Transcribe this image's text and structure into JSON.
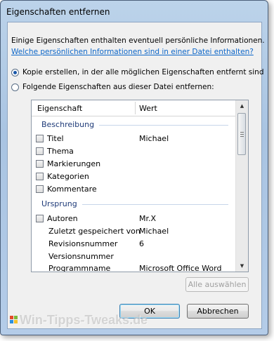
{
  "window": {
    "title": "Eigenschaften entfernen"
  },
  "info_text": "Einige Eigenschaften enthalten eventuell persönliche Informationen.",
  "info_link": "Welche persönlichen Informationen sind in einer Datei enthalten?",
  "options": [
    {
      "label": "Kopie erstellen, in der alle möglichen Eigenschaften entfernt sind",
      "selected": true
    },
    {
      "label": "Folgende Eigenschaften aus dieser Datei entfernen:",
      "selected": false
    }
  ],
  "list": {
    "columns": [
      "Eigenschaft",
      "Wert"
    ],
    "groups": [
      {
        "name": "Beschreibung",
        "items": [
          {
            "label": "Titel",
            "value": "Michael",
            "checkbox": true
          },
          {
            "label": "Thema",
            "value": "",
            "checkbox": true
          },
          {
            "label": "Markierungen",
            "value": "",
            "checkbox": true
          },
          {
            "label": "Kategorien",
            "value": "",
            "checkbox": true
          },
          {
            "label": "Kommentare",
            "value": "",
            "checkbox": true
          }
        ]
      },
      {
        "name": "Ursprung",
        "items": [
          {
            "label": "Autoren",
            "value": "Mr.X",
            "checkbox": true
          },
          {
            "label": "Zuletzt gespeichert von",
            "value": "Michael",
            "checkbox": false
          },
          {
            "label": "Revisionsnummer",
            "value": "6",
            "checkbox": false
          },
          {
            "label": "Versionsnummer",
            "value": "",
            "checkbox": false
          },
          {
            "label": "Programmname",
            "value": "Microsoft Office Word",
            "checkbox": false
          }
        ]
      }
    ]
  },
  "buttons": {
    "select_all": "Alle auswählen",
    "ok": "OK",
    "cancel": "Abbrechen"
  },
  "watermark": "Win-Tipps-Tweaks.de",
  "colors": {
    "link": "#0c66c8",
    "group_header": "#1e3a78"
  }
}
